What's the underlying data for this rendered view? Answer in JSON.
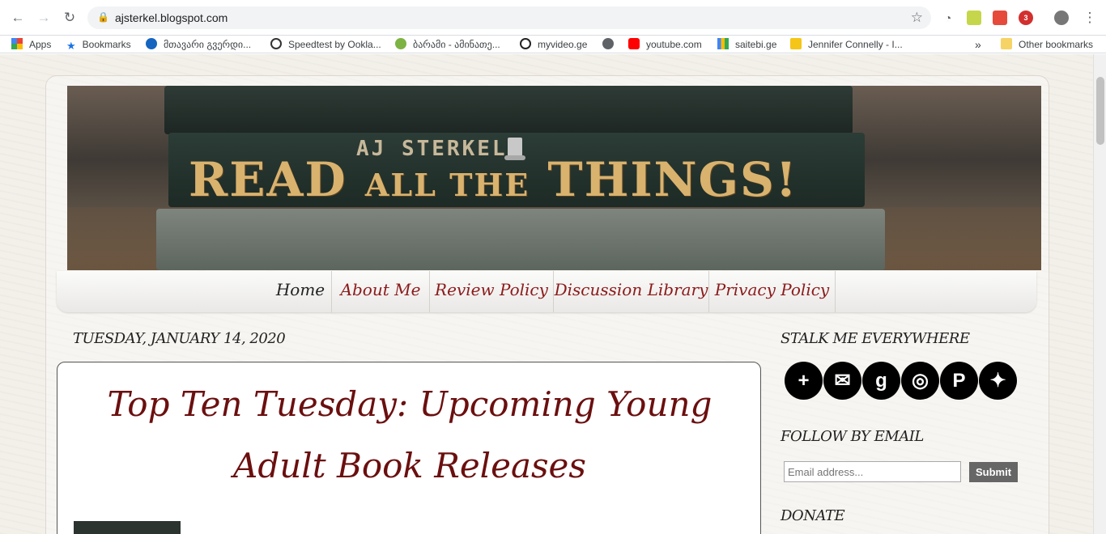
{
  "browser": {
    "url": "ajsterkel.blogspot.com",
    "bookmarks": [
      {
        "label": "Apps"
      },
      {
        "label": "Bookmarks"
      },
      {
        "label": "მთავარი გვერდი..."
      },
      {
        "label": "Speedtest by Ookla..."
      },
      {
        "label": "ბარამი - ამინათე..."
      },
      {
        "label": "myvideo.ge"
      },
      {
        "label": ""
      },
      {
        "label": "youtube.com"
      },
      {
        "label": "saitebi.ge"
      },
      {
        "label": "Jennifer Connelly - I..."
      },
      {
        "label": "Other bookmarks"
      }
    ],
    "overflow_label": "»",
    "extension_badge": "3"
  },
  "banner": {
    "author": "AJ STERKEL",
    "title_a": "READ",
    "title_b": "ALL THE",
    "title_c": "THINGS!"
  },
  "nav": {
    "items": [
      "Home",
      "About Me",
      "Review Policy",
      "Discussion Library",
      "Privacy Policy"
    ]
  },
  "post": {
    "date": "TUESDAY, JANUARY 14, 2020",
    "title": "Top Ten Tuesday: Upcoming Young Adult Book Releases"
  },
  "sidebar": {
    "stalk_title": "STALK ME EVERYWHERE",
    "social": [
      {
        "icon": "plus-icon",
        "glyph": "+"
      },
      {
        "icon": "mail-icon",
        "glyph": "✉"
      },
      {
        "icon": "goodreads-icon",
        "glyph": "g"
      },
      {
        "icon": "instagram-icon",
        "glyph": "◎"
      },
      {
        "icon": "pinterest-icon",
        "glyph": "P"
      },
      {
        "icon": "twitter-icon",
        "glyph": "✦"
      }
    ],
    "follow_title": "FOLLOW BY EMAIL",
    "email_placeholder": "Email address...",
    "submit_label": "Submit",
    "donate_title": "DONATE"
  }
}
